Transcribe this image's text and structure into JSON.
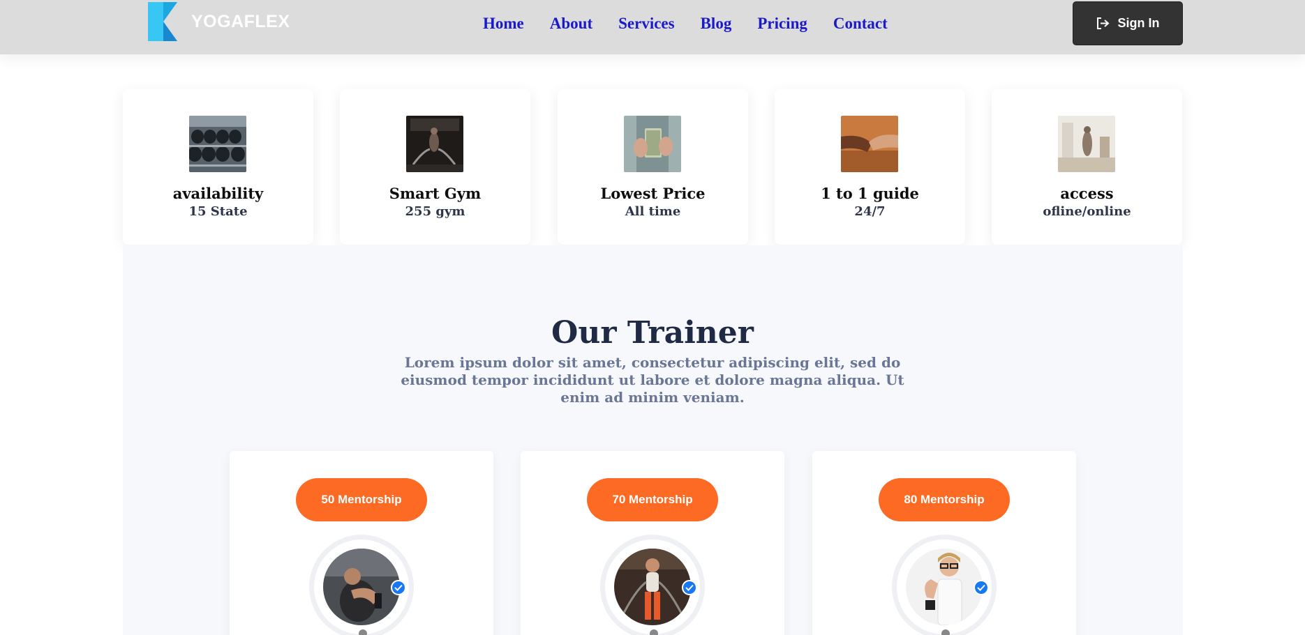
{
  "brand": {
    "name": "YOGAFLEX"
  },
  "nav": {
    "items": [
      "Home",
      "About",
      "Services",
      "Blog",
      "Pricing",
      "Contact"
    ]
  },
  "signin": {
    "label": "Sign In",
    "icon": "sign-in-icon"
  },
  "features": [
    {
      "title": "availability",
      "subtitle": "15 State",
      "image": "dumbbell-rack-photo"
    },
    {
      "title": "Smart Gym",
      "subtitle": "255 gym",
      "image": "battle-ropes-photo"
    },
    {
      "title": "Lowest Price",
      "subtitle": "All time",
      "image": "cash-in-hands-photo"
    },
    {
      "title": "1 to 1 guide",
      "subtitle": "24/7",
      "image": "handshake-photo"
    },
    {
      "title": "access",
      "subtitle": "ofline/online",
      "image": "home-workout-photo"
    }
  ],
  "trainer_section": {
    "title": "Our Trainer",
    "description": "Lorem ipsum dolor sit amet, consectetur adipiscing elit, sed do eiusmod tempor incididunt ut labore et dolore magna aliqua. Ut enim ad minim veniam."
  },
  "trainers": [
    {
      "badge": "50 Mentorship",
      "verified": true
    },
    {
      "badge": "70 Mentorship",
      "verified": true
    },
    {
      "badge": "80 Mentorship",
      "verified": true
    }
  ],
  "colors": {
    "accent": "#fd6a23",
    "nav_link": "#1a1ac9",
    "verify": "#1877f2",
    "heading": "#1f2a44"
  }
}
